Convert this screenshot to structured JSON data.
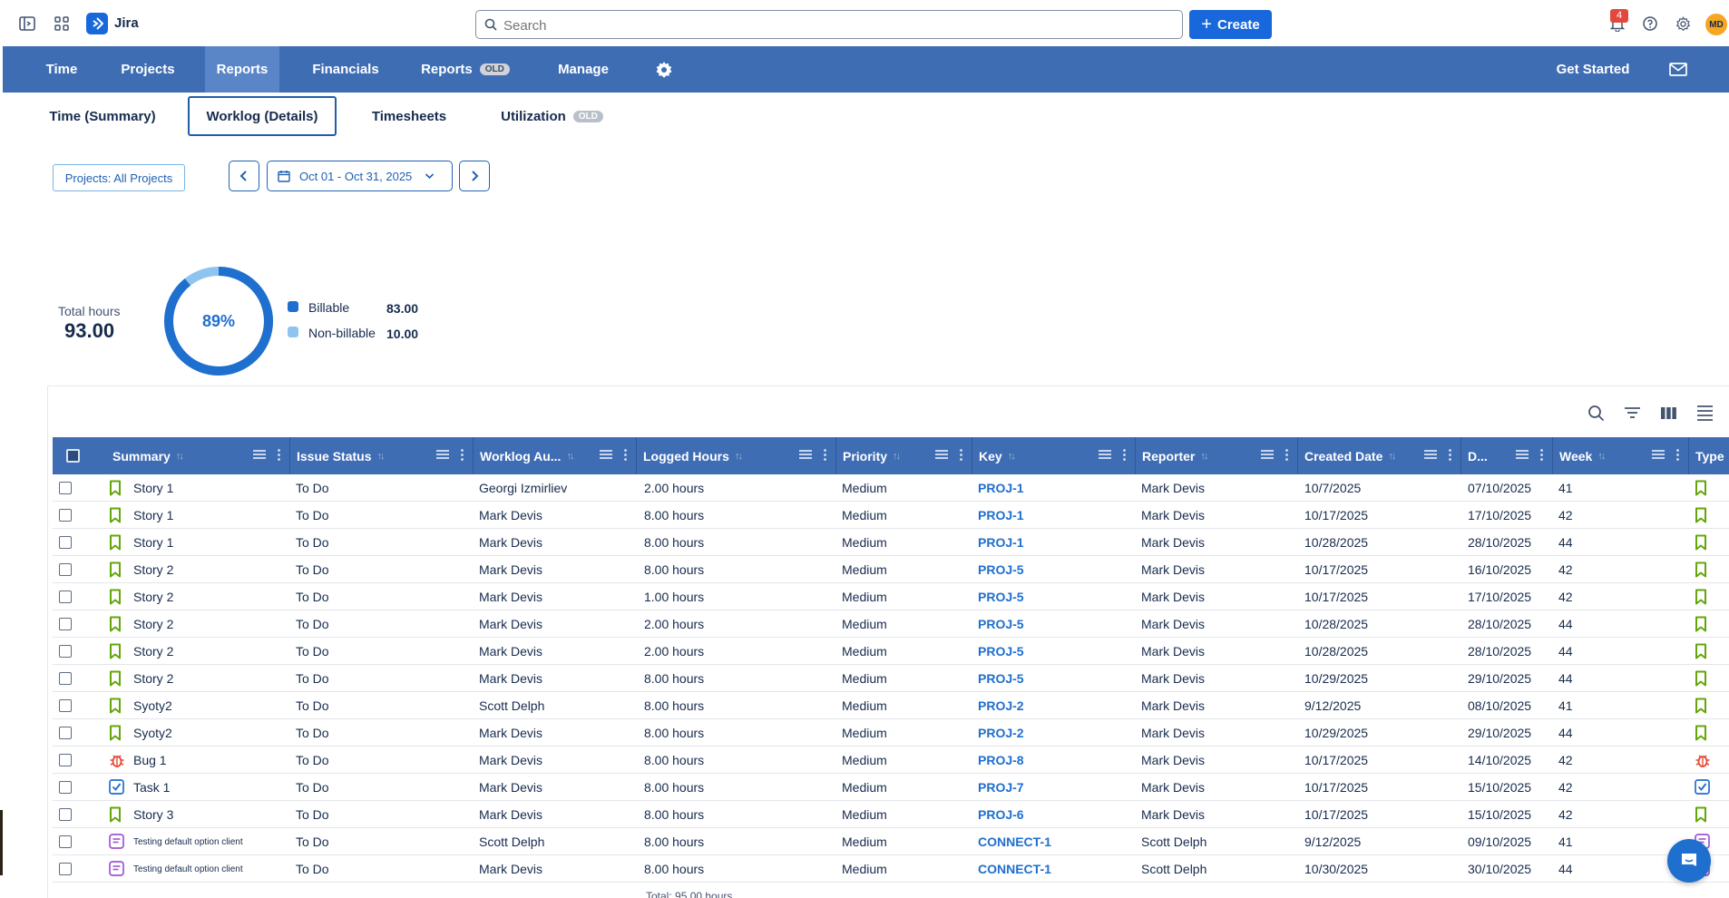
{
  "app": {
    "name": "Jira"
  },
  "search": {
    "placeholder": "Search"
  },
  "create_label": "Create",
  "notifications_count": "4",
  "user_initials": "MD",
  "main_nav": {
    "items": [
      "Time",
      "Projects",
      "Reports",
      "Financials",
      "Reports",
      "Manage"
    ],
    "old_badge": "OLD",
    "get_started": "Get Started"
  },
  "sub_tabs": {
    "items": [
      "Time (Summary)",
      "Worklog (Details)",
      "Timesheets",
      "Utilization"
    ],
    "old_badge": "OLD"
  },
  "filters": {
    "projects": "Projects: All Projects",
    "date_range": "Oct 01 - Oct 31, 2025"
  },
  "summary": {
    "total_label": "Total hours",
    "total_value": "93.00",
    "billable_percent": "89%",
    "billable_fraction": 0.8925,
    "legend": [
      {
        "label": "Billable",
        "value": "83.00",
        "color": "#1f6fce"
      },
      {
        "label": "Non-billable",
        "value": "10.00",
        "color": "#8fc3f0"
      }
    ]
  },
  "table": {
    "columns": [
      "Summary",
      "Issue Status",
      "Worklog Au...",
      "Logged Hours",
      "Priority",
      "Key",
      "Reporter",
      "Created Date",
      "D...",
      "Week",
      "Type"
    ],
    "rows": [
      {
        "type": "story",
        "summary": "Story 1",
        "status": "To Do",
        "author": "Georgi Izmirliev",
        "hours": "2.00 hours",
        "priority": "Medium",
        "key": "PROJ-1",
        "reporter": "Mark Devis",
        "created": "10/7/2025",
        "date": "07/10/2025",
        "week": "41"
      },
      {
        "type": "story",
        "summary": "Story 1",
        "status": "To Do",
        "author": "Mark Devis",
        "hours": "8.00 hours",
        "priority": "Medium",
        "key": "PROJ-1",
        "reporter": "Mark Devis",
        "created": "10/17/2025",
        "date": "17/10/2025",
        "week": "42"
      },
      {
        "type": "story",
        "summary": "Story 1",
        "status": "To Do",
        "author": "Mark Devis",
        "hours": "8.00 hours",
        "priority": "Medium",
        "key": "PROJ-1",
        "reporter": "Mark Devis",
        "created": "10/28/2025",
        "date": "28/10/2025",
        "week": "44"
      },
      {
        "type": "story",
        "summary": "Story 2",
        "status": "To Do",
        "author": "Mark Devis",
        "hours": "8.00 hours",
        "priority": "Medium",
        "key": "PROJ-5",
        "reporter": "Mark Devis",
        "created": "10/17/2025",
        "date": "16/10/2025",
        "week": "42"
      },
      {
        "type": "story",
        "summary": "Story 2",
        "status": "To Do",
        "author": "Mark Devis",
        "hours": "1.00 hours",
        "priority": "Medium",
        "key": "PROJ-5",
        "reporter": "Mark Devis",
        "created": "10/17/2025",
        "date": "17/10/2025",
        "week": "42"
      },
      {
        "type": "story",
        "summary": "Story 2",
        "status": "To Do",
        "author": "Mark Devis",
        "hours": "2.00 hours",
        "priority": "Medium",
        "key": "PROJ-5",
        "reporter": "Mark Devis",
        "created": "10/28/2025",
        "date": "28/10/2025",
        "week": "44"
      },
      {
        "type": "story",
        "summary": "Story 2",
        "status": "To Do",
        "author": "Mark Devis",
        "hours": "2.00 hours",
        "priority": "Medium",
        "key": "PROJ-5",
        "reporter": "Mark Devis",
        "created": "10/28/2025",
        "date": "28/10/2025",
        "week": "44"
      },
      {
        "type": "story",
        "summary": "Story 2",
        "status": "To Do",
        "author": "Mark Devis",
        "hours": "8.00 hours",
        "priority": "Medium",
        "key": "PROJ-5",
        "reporter": "Mark Devis",
        "created": "10/29/2025",
        "date": "29/10/2025",
        "week": "44"
      },
      {
        "type": "story",
        "summary": "Syoty2",
        "status": "To Do",
        "author": "Scott Delph",
        "hours": "8.00 hours",
        "priority": "Medium",
        "key": "PROJ-2",
        "reporter": "Mark Devis",
        "created": "9/12/2025",
        "date": "08/10/2025",
        "week": "41"
      },
      {
        "type": "story",
        "summary": "Syoty2",
        "status": "To Do",
        "author": "Mark Devis",
        "hours": "8.00 hours",
        "priority": "Medium",
        "key": "PROJ-2",
        "reporter": "Mark Devis",
        "created": "10/29/2025",
        "date": "29/10/2025",
        "week": "44"
      },
      {
        "type": "bug",
        "summary": "Bug 1",
        "status": "To Do",
        "author": "Mark Devis",
        "hours": "8.00 hours",
        "priority": "Medium",
        "key": "PROJ-8",
        "reporter": "Mark Devis",
        "created": "10/17/2025",
        "date": "14/10/2025",
        "week": "42"
      },
      {
        "type": "task",
        "summary": "Task 1",
        "status": "To Do",
        "author": "Mark Devis",
        "hours": "8.00 hours",
        "priority": "Medium",
        "key": "PROJ-7",
        "reporter": "Mark Devis",
        "created": "10/17/2025",
        "date": "15/10/2025",
        "week": "42"
      },
      {
        "type": "story",
        "summary": "Story 3",
        "status": "To Do",
        "author": "Mark Devis",
        "hours": "8.00 hours",
        "priority": "Medium",
        "key": "PROJ-6",
        "reporter": "Mark Devis",
        "created": "10/17/2025",
        "date": "15/10/2025",
        "week": "42"
      },
      {
        "type": "request",
        "summary": "Testing default option client",
        "status": "To Do",
        "author": "Scott Delph",
        "hours": "8.00 hours",
        "priority": "Medium",
        "key": "CONNECT-1",
        "reporter": "Scott Delph",
        "created": "9/12/2025",
        "date": "09/10/2025",
        "week": "41"
      },
      {
        "type": "request",
        "summary": "Testing default option client",
        "status": "To Do",
        "author": "Mark Devis",
        "hours": "8.00 hours",
        "priority": "Medium",
        "key": "CONNECT-1",
        "reporter": "Scott Delph",
        "created": "10/30/2025",
        "date": "30/10/2025",
        "week": "44"
      }
    ],
    "footer_total": "Total: 95.00 hours"
  },
  "colors": {
    "nav_bg": "#3f6db3",
    "accent": "#1f6fce",
    "story": "#63a60a",
    "bug": "#e34935",
    "task": "#1f6fce",
    "request": "#a054d6"
  }
}
